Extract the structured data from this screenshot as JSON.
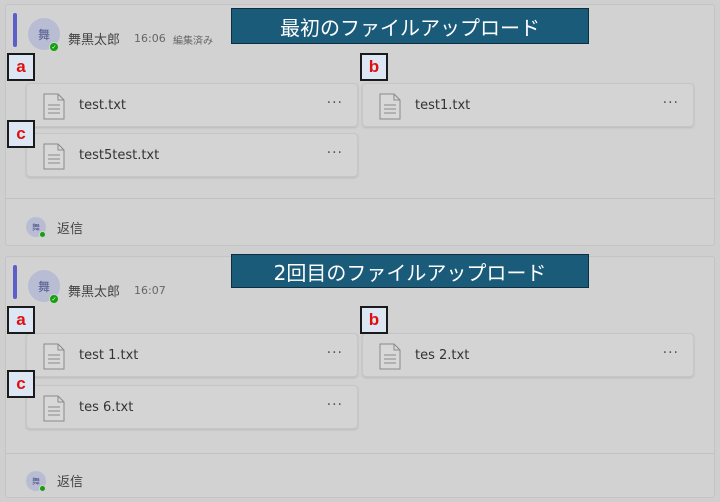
{
  "posts": [
    {
      "avatar_char": "舞",
      "author": "舞黒太郎",
      "time": "16:06",
      "edited": "編集済み",
      "files": [
        {
          "name": "test.txt",
          "more": "···"
        },
        {
          "name": "test1.txt",
          "more": "···"
        },
        {
          "name": "test5test.txt",
          "more": "···"
        }
      ],
      "reply_label": "返信"
    },
    {
      "avatar_char": "舞",
      "author": "舞黒太郎",
      "time": "16:07",
      "files": [
        {
          "name": "test 1.txt",
          "more": "···"
        },
        {
          "name": "tes 2.txt",
          "more": "···"
        },
        {
          "name": "tes 6.txt",
          "more": "···"
        }
      ],
      "reply_label": "返信"
    }
  ],
  "annotations": {
    "banner1": "最初のファイルアップロード",
    "banner2": "2回目のファイルアップロード",
    "markers": [
      "a",
      "b",
      "c"
    ]
  },
  "colors": {
    "accent": "#5b5fc7",
    "presence": "#13a10e",
    "banner_bg": "#1b5b7a",
    "marker_text": "#e01010"
  }
}
